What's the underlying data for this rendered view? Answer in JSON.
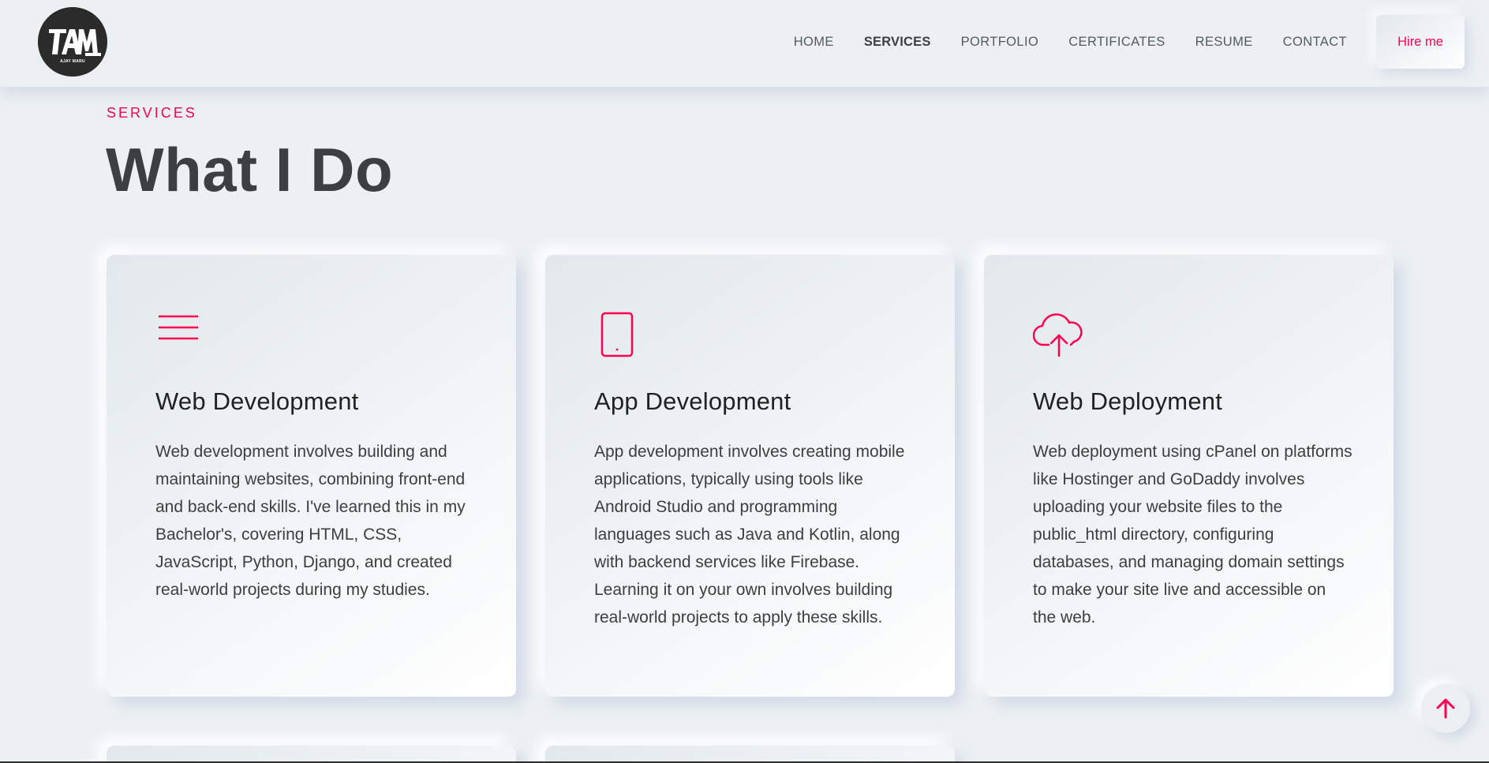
{
  "brand": {
    "logo_text": "AM",
    "logo_subtext": "AJAY MARU"
  },
  "nav": {
    "items": [
      {
        "label": "HOME"
      },
      {
        "label": "SERVICES"
      },
      {
        "label": "PORTFOLIO"
      },
      {
        "label": "CERTIFICATES"
      },
      {
        "label": "RESUME"
      },
      {
        "label": "CONTACT"
      }
    ],
    "active": "SERVICES",
    "cta_label": "Hire me"
  },
  "section": {
    "kicker": "SERVICES",
    "title": "What I Do"
  },
  "services": [
    {
      "icon": "menu-icon",
      "title": "Web Development",
      "text": "Web development involves building and maintaining websites, combining front-end and back-end skills. I've learned this in my Bachelor's, covering HTML, CSS, JavaScript, Python, Django, and created real-world projects during my studies."
    },
    {
      "icon": "smartphone-icon",
      "title": "App Development",
      "text": "App development involves creating mobile applications, typically using tools like Android Studio and programming languages such as Java and Kotlin, along with backend services like Firebase. Learning it on your own involves building real-world projects to apply these skills."
    },
    {
      "icon": "cloud-upload-icon",
      "title": "Web Deployment",
      "text": "Web deployment using cPanel on platforms like Hostinger and GoDaddy involves uploading your website files to the public_html directory, configuring databases, and managing domain settings to make your site live and accessible on the web."
    }
  ],
  "colors": {
    "accent": "#ff014f",
    "background": "#ecf0f3",
    "heading": "#3c3e41"
  },
  "scroll_top_icon": "arrow-up-icon"
}
